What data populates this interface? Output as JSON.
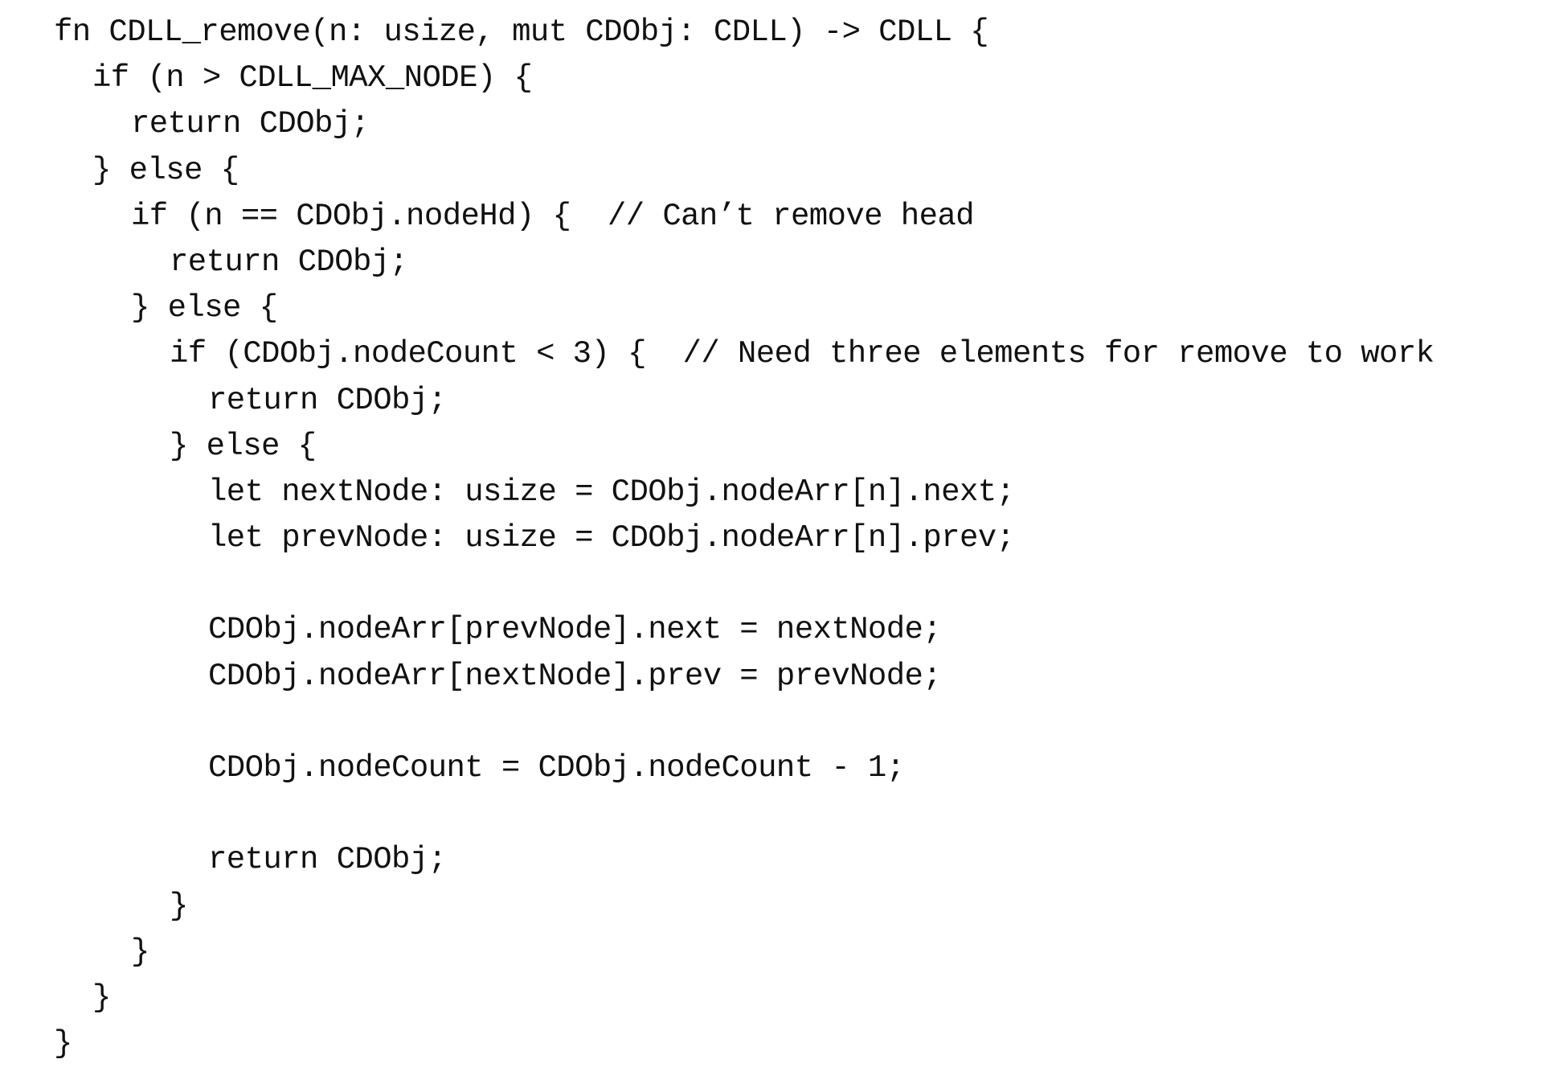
{
  "document": {
    "language": "rust",
    "lines": [
      {
        "indent": 0,
        "code": "fn CDLL_remove(n: usize, mut CDObj: CDLL) -> CDLL {",
        "comment": ""
      },
      {
        "indent": 1,
        "code": "if (n > CDLL_MAX_NODE) {",
        "comment": ""
      },
      {
        "indent": 2,
        "code": "return CDObj;",
        "comment": ""
      },
      {
        "indent": 1,
        "code": "} else {",
        "comment": ""
      },
      {
        "indent": 2,
        "code": "if (n == CDObj.nodeHd) {  ",
        "comment": "// Can’t remove head"
      },
      {
        "indent": 3,
        "code": "return CDObj;",
        "comment": ""
      },
      {
        "indent": 2,
        "code": "} else {",
        "comment": ""
      },
      {
        "indent": 3,
        "code": "if (CDObj.nodeCount < 3) {  ",
        "comment": "// Need three elements for remove to work"
      },
      {
        "indent": 4,
        "code": "return CDObj;",
        "comment": ""
      },
      {
        "indent": 3,
        "code": "} else {",
        "comment": ""
      },
      {
        "indent": 4,
        "code": "let nextNode: usize = CDObj.nodeArr[n].next;",
        "comment": ""
      },
      {
        "indent": 4,
        "code": "let prevNode: usize = CDObj.nodeArr[n].prev;",
        "comment": ""
      },
      {
        "indent": 0,
        "code": "",
        "comment": ""
      },
      {
        "indent": 4,
        "code": "CDObj.nodeArr[prevNode].next = nextNode;",
        "comment": ""
      },
      {
        "indent": 4,
        "code": "CDObj.nodeArr[nextNode].prev = prevNode;",
        "comment": ""
      },
      {
        "indent": 0,
        "code": "",
        "comment": ""
      },
      {
        "indent": 4,
        "code": "CDObj.nodeCount = CDObj.nodeCount - 1;",
        "comment": ""
      },
      {
        "indent": 0,
        "code": "",
        "comment": ""
      },
      {
        "indent": 4,
        "code": "return CDObj;",
        "comment": ""
      },
      {
        "indent": 3,
        "code": "}",
        "comment": ""
      },
      {
        "indent": 2,
        "code": "}",
        "comment": ""
      },
      {
        "indent": 1,
        "code": "}",
        "comment": ""
      },
      {
        "indent": 0,
        "code": "}",
        "comment": ""
      }
    ]
  }
}
